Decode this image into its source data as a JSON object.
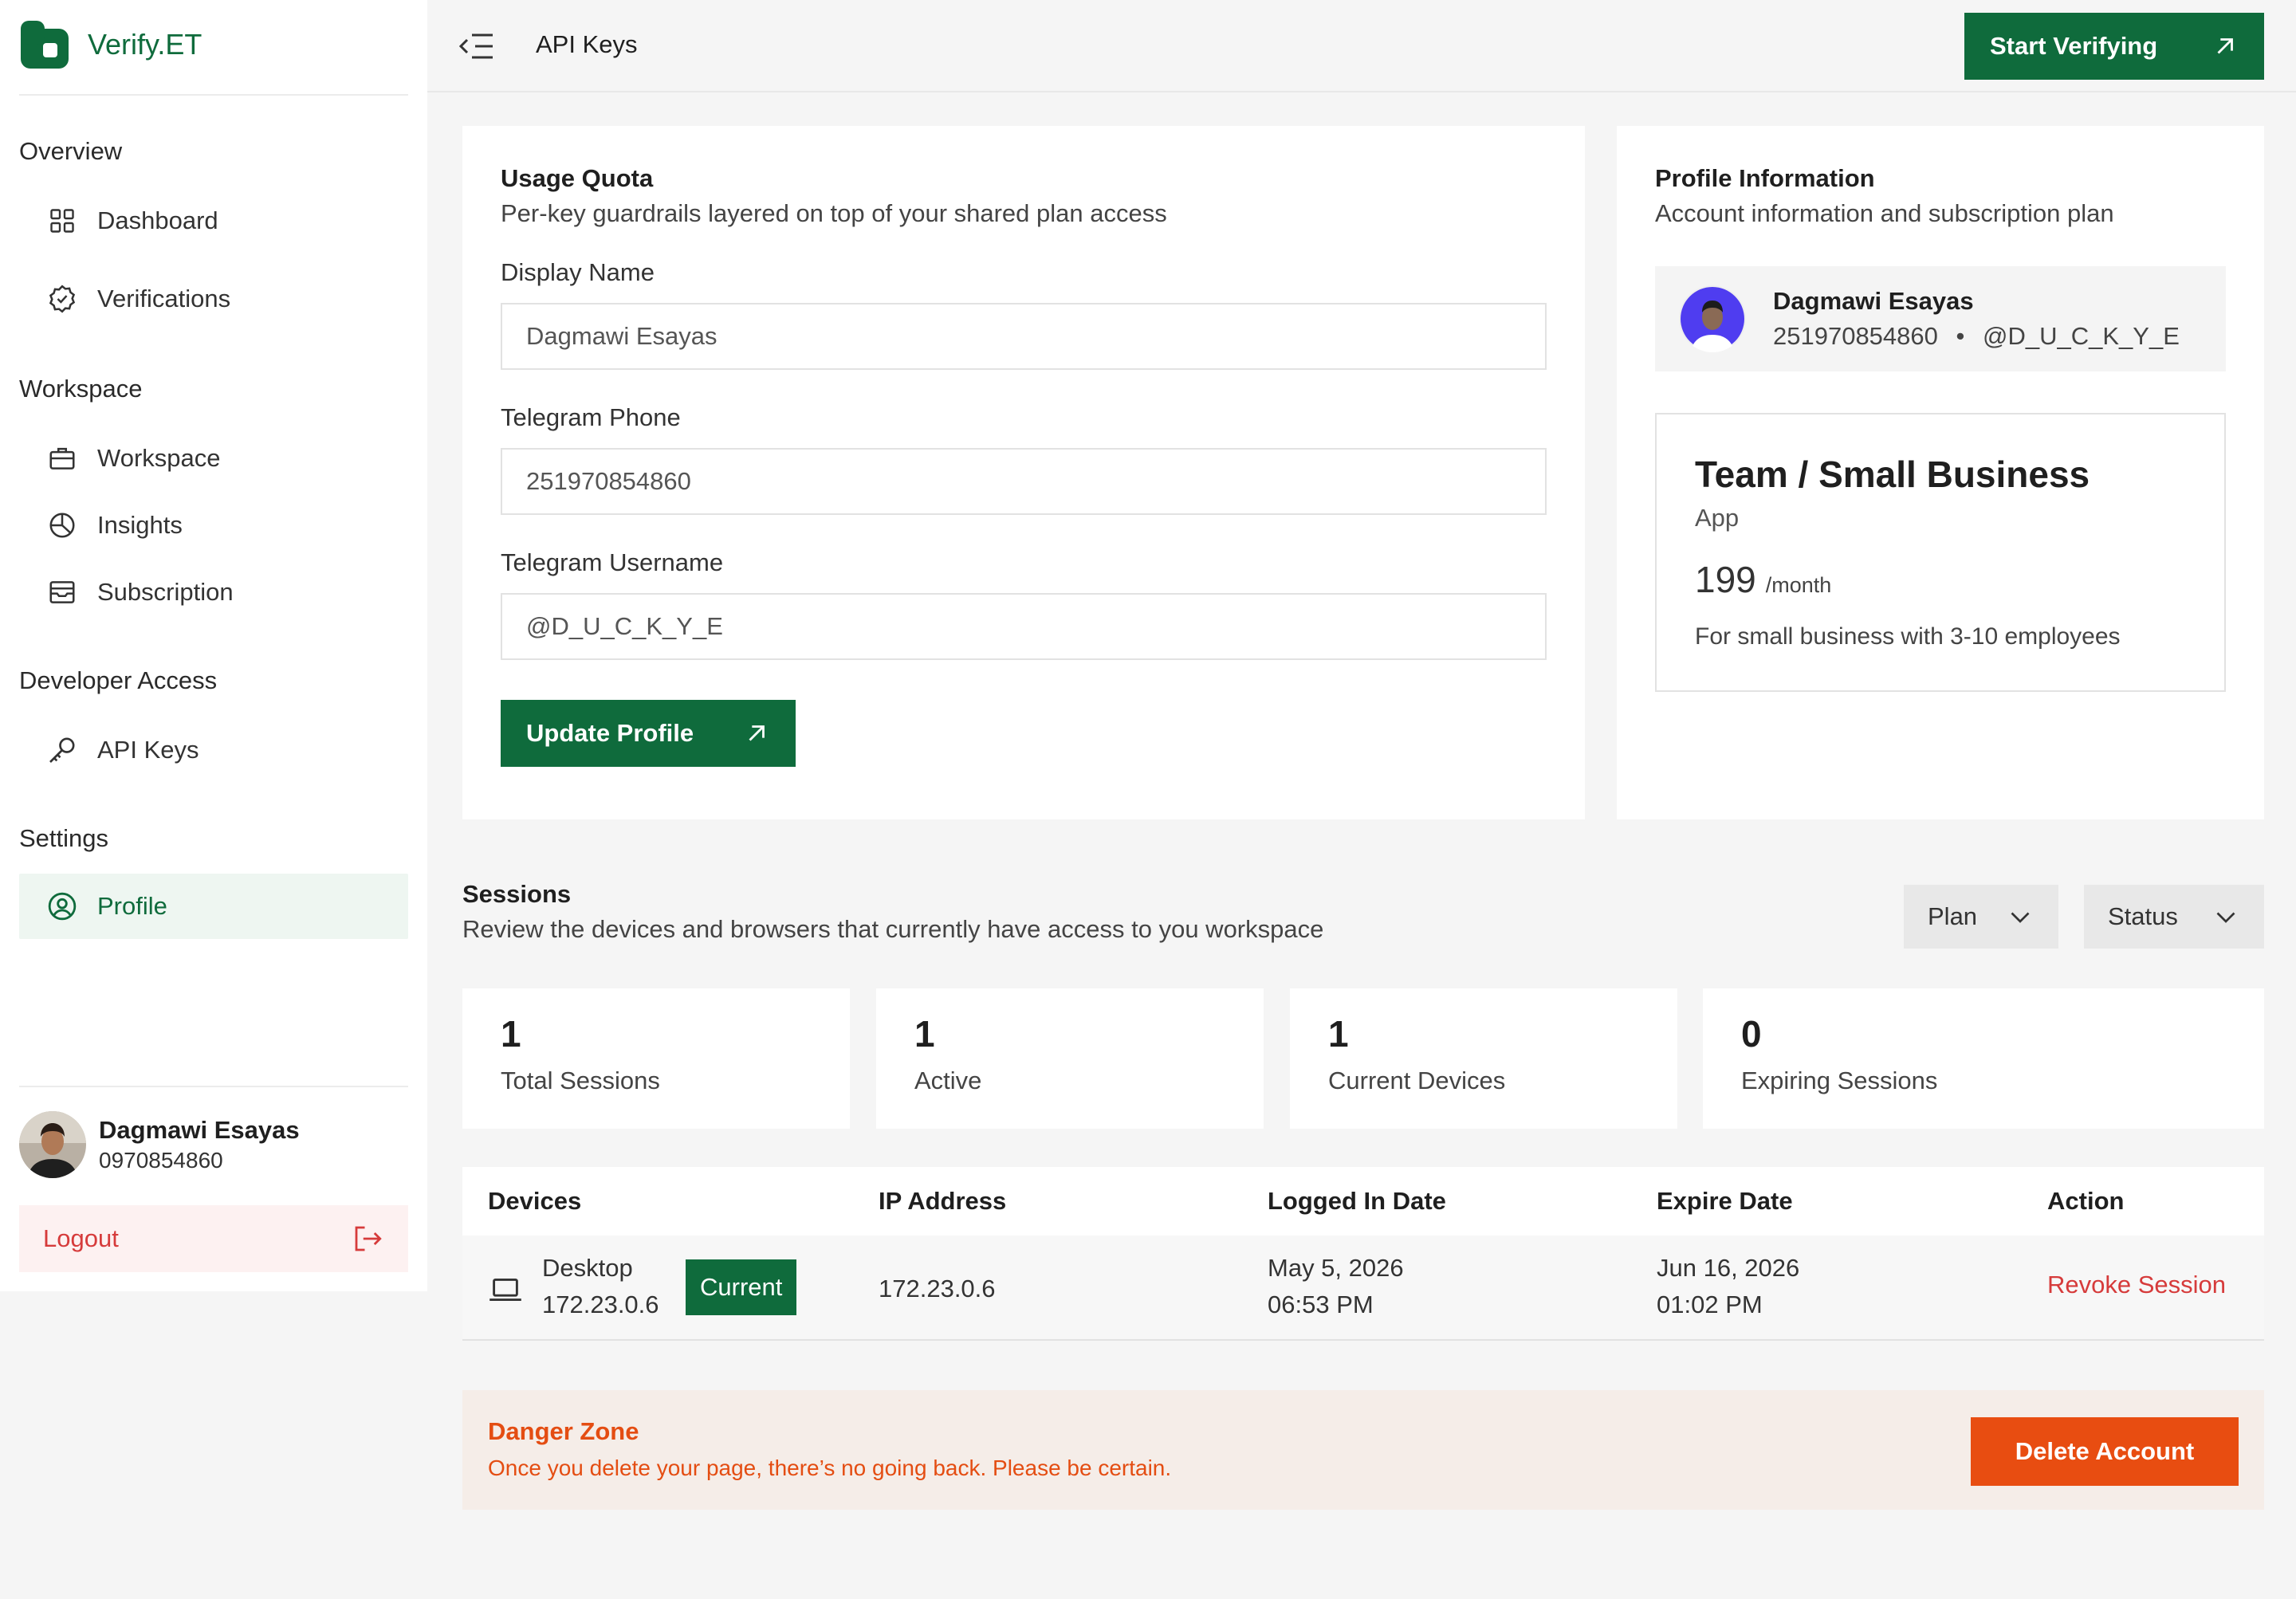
{
  "brand": {
    "name": "Verify.ET"
  },
  "sidebar": {
    "sections": [
      {
        "label": "Overview"
      },
      {
        "label": "Workspace"
      },
      {
        "label": "Developer Access"
      },
      {
        "label": "Settings"
      }
    ],
    "items": [
      {
        "label": "Dashboard",
        "icon": "grid-icon"
      },
      {
        "label": "Verifications",
        "icon": "badge-check-icon"
      },
      {
        "label": "Workspace",
        "icon": "briefcase-icon"
      },
      {
        "label": "Insights",
        "icon": "pie-chart-icon"
      },
      {
        "label": "Subscription",
        "icon": "inbox-icon"
      },
      {
        "label": "API Keys",
        "icon": "key-icon"
      },
      {
        "label": "Profile",
        "icon": "user-circle-icon",
        "active": true
      }
    ],
    "user": {
      "name": "Dagmawi Esayas",
      "phone": "0970854860"
    },
    "logout_label": "Logout"
  },
  "header": {
    "title": "API Keys",
    "start_label": "Start Verifying"
  },
  "usage": {
    "title": "Usage Quota",
    "subtitle": "Per-key guardrails layered on top of your shared plan access",
    "fields": [
      {
        "label": "Display Name",
        "value": "Dagmawi Esayas"
      },
      {
        "label": "Telegram Phone",
        "value": "251970854860"
      },
      {
        "label": "Telegram Username",
        "value": "@D_U_C_K_Y_E"
      }
    ],
    "update_label": "Update Profile"
  },
  "profile": {
    "title": "Profile Information",
    "subtitle": "Account information and subscription plan",
    "name": "Dagmawi Esayas",
    "phone": "251970854860",
    "separator": "•",
    "username": "@D_U_C_K_Y_E",
    "plan": {
      "name": "Team / Small Business",
      "type": "App",
      "price": "199",
      "period": "/month",
      "description": "For small business with 3-10 employees"
    }
  },
  "sessions": {
    "title": "Sessions",
    "subtitle": "Review the devices and browsers that currently have access to you workspace",
    "filters": {
      "plan": "Plan",
      "status": "Status"
    },
    "stats": [
      {
        "value": "1",
        "label": "Total Sessions"
      },
      {
        "value": "1",
        "label": "Active"
      },
      {
        "value": "1",
        "label": "Current Devices"
      },
      {
        "value": "0",
        "label": "Expiring Sessions"
      }
    ],
    "columns": [
      "Devices",
      "IP Address",
      "Logged In Date",
      "Expire Date",
      "Action"
    ],
    "rows": [
      {
        "device": "Desktop",
        "device_ip": "172.23.0.6",
        "badge": "Current",
        "ip": "172.23.0.6",
        "logged_date": "May 5, 2026",
        "logged_time": "06:53 PM",
        "expire_date": "Jun 16, 2026",
        "expire_time": "01:02 PM",
        "action": "Revoke Session"
      }
    ]
  },
  "danger": {
    "title": "Danger Zone",
    "text": "Once you delete your page, there’s no going back. Please be certain.",
    "delete_label": "Delete Account"
  },
  "colors": {
    "accent": "#0f6b3c",
    "danger": "#e84d11",
    "logout": "#d63b3b"
  }
}
